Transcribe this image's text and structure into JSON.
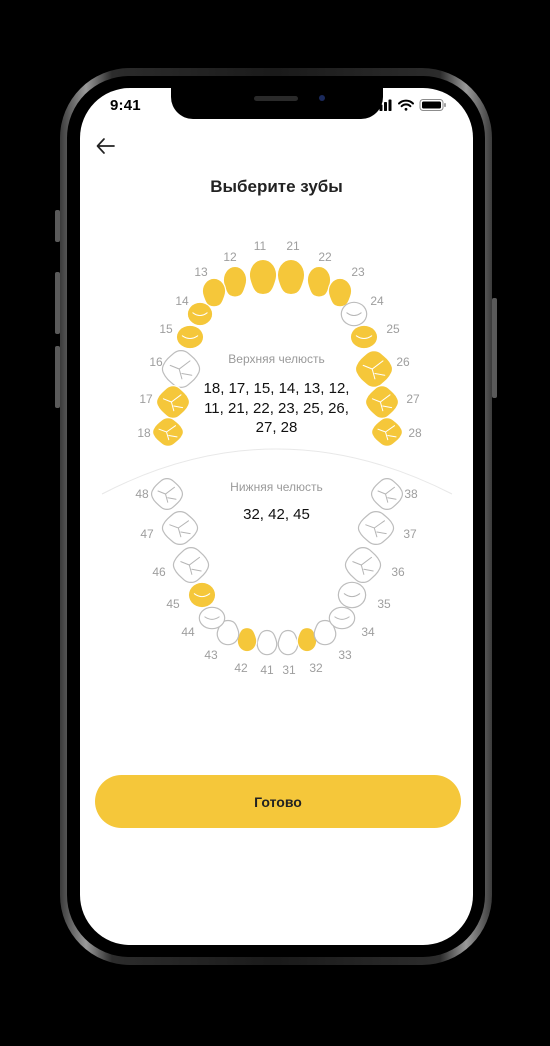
{
  "status_bar": {
    "time": "9:41"
  },
  "header": {
    "title": "Выберите зубы"
  },
  "upper_jaw": {
    "label": "Верхняя челюсть",
    "selected_text": "18, 17, 15, 14, 13, 12, 11, 21, 22, 23, 25, 26, 27, 28"
  },
  "lower_jaw": {
    "label": "Нижняя челюсть",
    "selected_text": "32, 42, 45"
  },
  "teeth": [
    {
      "num": "11",
      "selected": true
    },
    {
      "num": "12",
      "selected": true
    },
    {
      "num": "13",
      "selected": true
    },
    {
      "num": "14",
      "selected": true
    },
    {
      "num": "15",
      "selected": true
    },
    {
      "num": "16",
      "selected": false
    },
    {
      "num": "17",
      "selected": true
    },
    {
      "num": "18",
      "selected": true
    },
    {
      "num": "21",
      "selected": true
    },
    {
      "num": "22",
      "selected": true
    },
    {
      "num": "23",
      "selected": true
    },
    {
      "num": "24",
      "selected": false
    },
    {
      "num": "25",
      "selected": true
    },
    {
      "num": "26",
      "selected": true
    },
    {
      "num": "27",
      "selected": true
    },
    {
      "num": "28",
      "selected": true
    },
    {
      "num": "31",
      "selected": false
    },
    {
      "num": "32",
      "selected": true
    },
    {
      "num": "33",
      "selected": false
    },
    {
      "num": "34",
      "selected": false
    },
    {
      "num": "35",
      "selected": false
    },
    {
      "num": "36",
      "selected": false
    },
    {
      "num": "37",
      "selected": false
    },
    {
      "num": "38",
      "selected": false
    },
    {
      "num": "41",
      "selected": false
    },
    {
      "num": "42",
      "selected": true
    },
    {
      "num": "43",
      "selected": false
    },
    {
      "num": "44",
      "selected": false
    },
    {
      "num": "45",
      "selected": true
    },
    {
      "num": "46",
      "selected": false
    },
    {
      "num": "47",
      "selected": false
    },
    {
      "num": "48",
      "selected": false
    }
  ],
  "colors": {
    "selected": "#f5c73a",
    "unselected": "#ffffff",
    "tooth_stroke": "#bdbdbd",
    "number": "#9e9e9e"
  },
  "actions": {
    "done_label": "Готово"
  }
}
